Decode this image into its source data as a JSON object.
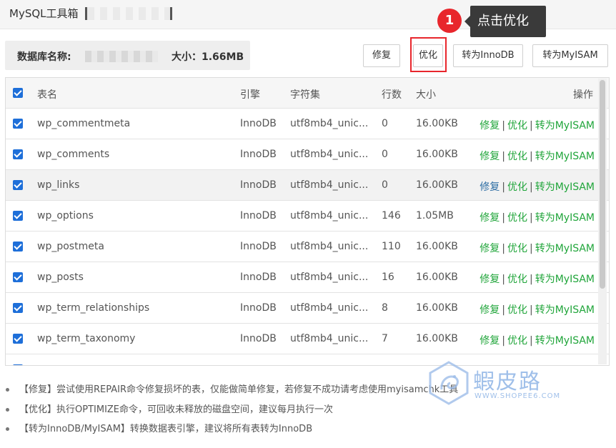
{
  "window": {
    "title": "MySQL工具箱【"
  },
  "tooltip": {
    "step": "1",
    "text": "点击优化"
  },
  "dbinfo": {
    "name_label": "数据库名称:",
    "size_label": "大小：1.66MB"
  },
  "buttons": {
    "repair": "修复",
    "optimize": "优化",
    "to_innodb": "转为InnoDB",
    "to_myisam": "转为MyISAM"
  },
  "table": {
    "headers": {
      "name": "表名",
      "engine": "引擎",
      "charset": "字符集",
      "rows": "行数",
      "size": "大小",
      "ops": "操作"
    },
    "op_labels": {
      "repair": "修复",
      "optimize": "优化",
      "convert": "转为MyISAM",
      "sep": "|"
    },
    "rows": [
      {
        "name": "wp_commentmeta",
        "engine": "InnoDB",
        "charset": "utf8mb4_unic...",
        "rows": "0",
        "size": "16.00KB"
      },
      {
        "name": "wp_comments",
        "engine": "InnoDB",
        "charset": "utf8mb4_unic...",
        "rows": "0",
        "size": "16.00KB"
      },
      {
        "name": "wp_links",
        "engine": "InnoDB",
        "charset": "utf8mb4_unic...",
        "rows": "0",
        "size": "16.00KB"
      },
      {
        "name": "wp_options",
        "engine": "InnoDB",
        "charset": "utf8mb4_unic...",
        "rows": "146",
        "size": "1.05MB"
      },
      {
        "name": "wp_postmeta",
        "engine": "InnoDB",
        "charset": "utf8mb4_unic...",
        "rows": "110",
        "size": "16.00KB"
      },
      {
        "name": "wp_posts",
        "engine": "InnoDB",
        "charset": "utf8mb4_unic...",
        "rows": "16",
        "size": "16.00KB"
      },
      {
        "name": "wp_term_relationships",
        "engine": "InnoDB",
        "charset": "utf8mb4_unic...",
        "rows": "8",
        "size": "16.00KB"
      },
      {
        "name": "wp_term_taxonomy",
        "engine": "InnoDB",
        "charset": "utf8mb4_unic...",
        "rows": "7",
        "size": "16.00KB"
      }
    ]
  },
  "notes": [
    "【修复】尝试使用REPAIR命令修复损坏的表，仅能做简单修复，若修复不成功请考虑使用myisamchk工具",
    "【优化】执行OPTIMIZE命令，可回收未释放的磁盘空间，建议每月执行一次",
    "【转为InnoDB/MyISAM】转换数据表引擎，建议将所有表转为InnoDB"
  ],
  "watermark": {
    "brand": "蝦皮路",
    "site": "WWW.SHOPEE6.COM"
  },
  "colors": {
    "green": "#20a53a",
    "red": "#e8262c",
    "blue": "#1e6fd9"
  }
}
